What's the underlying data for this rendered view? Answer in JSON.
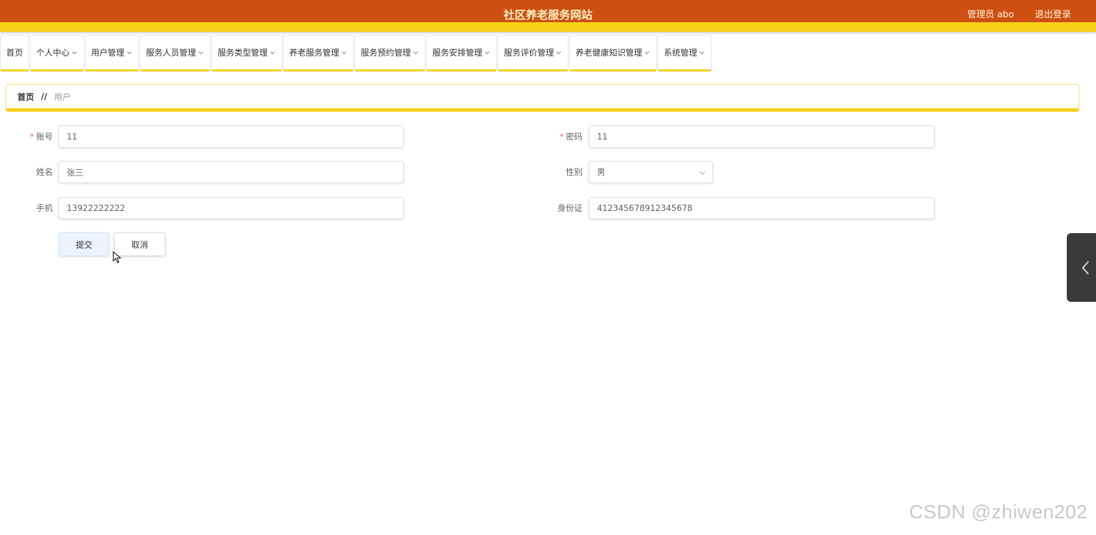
{
  "header": {
    "title": "社区养老服务网站",
    "user": "管理员 abo",
    "logout": "退出登录",
    "bg_color": "#cd4f12",
    "stripe_color": "#f7d11a"
  },
  "nav": {
    "items": [
      {
        "label": "首页"
      },
      {
        "label": "个人中心"
      },
      {
        "label": "用户管理"
      },
      {
        "label": "服务人员管理"
      },
      {
        "label": "服务类型管理"
      },
      {
        "label": "养老服务管理"
      },
      {
        "label": "服务预约管理"
      },
      {
        "label": "服务安排管理"
      },
      {
        "label": "服务评价管理"
      },
      {
        "label": "养老健康知识管理"
      },
      {
        "label": "系统管理"
      }
    ]
  },
  "breadcrumb": {
    "home": "首页",
    "separator": "//",
    "current": "用户"
  },
  "form": {
    "account": {
      "label": "账号",
      "value": "11",
      "required": "*"
    },
    "password": {
      "label": "密码",
      "value": "11",
      "required": "*"
    },
    "name": {
      "label": "姓名",
      "value": "张三"
    },
    "gender": {
      "label": "性别",
      "value": "男"
    },
    "phone": {
      "label": "手机",
      "value": "13922222222"
    },
    "idcard": {
      "label": "身份证",
      "value": "412345678912345678"
    },
    "submit": "提交",
    "cancel": "取消"
  },
  "watermark": "CSDN @zhiwen202"
}
